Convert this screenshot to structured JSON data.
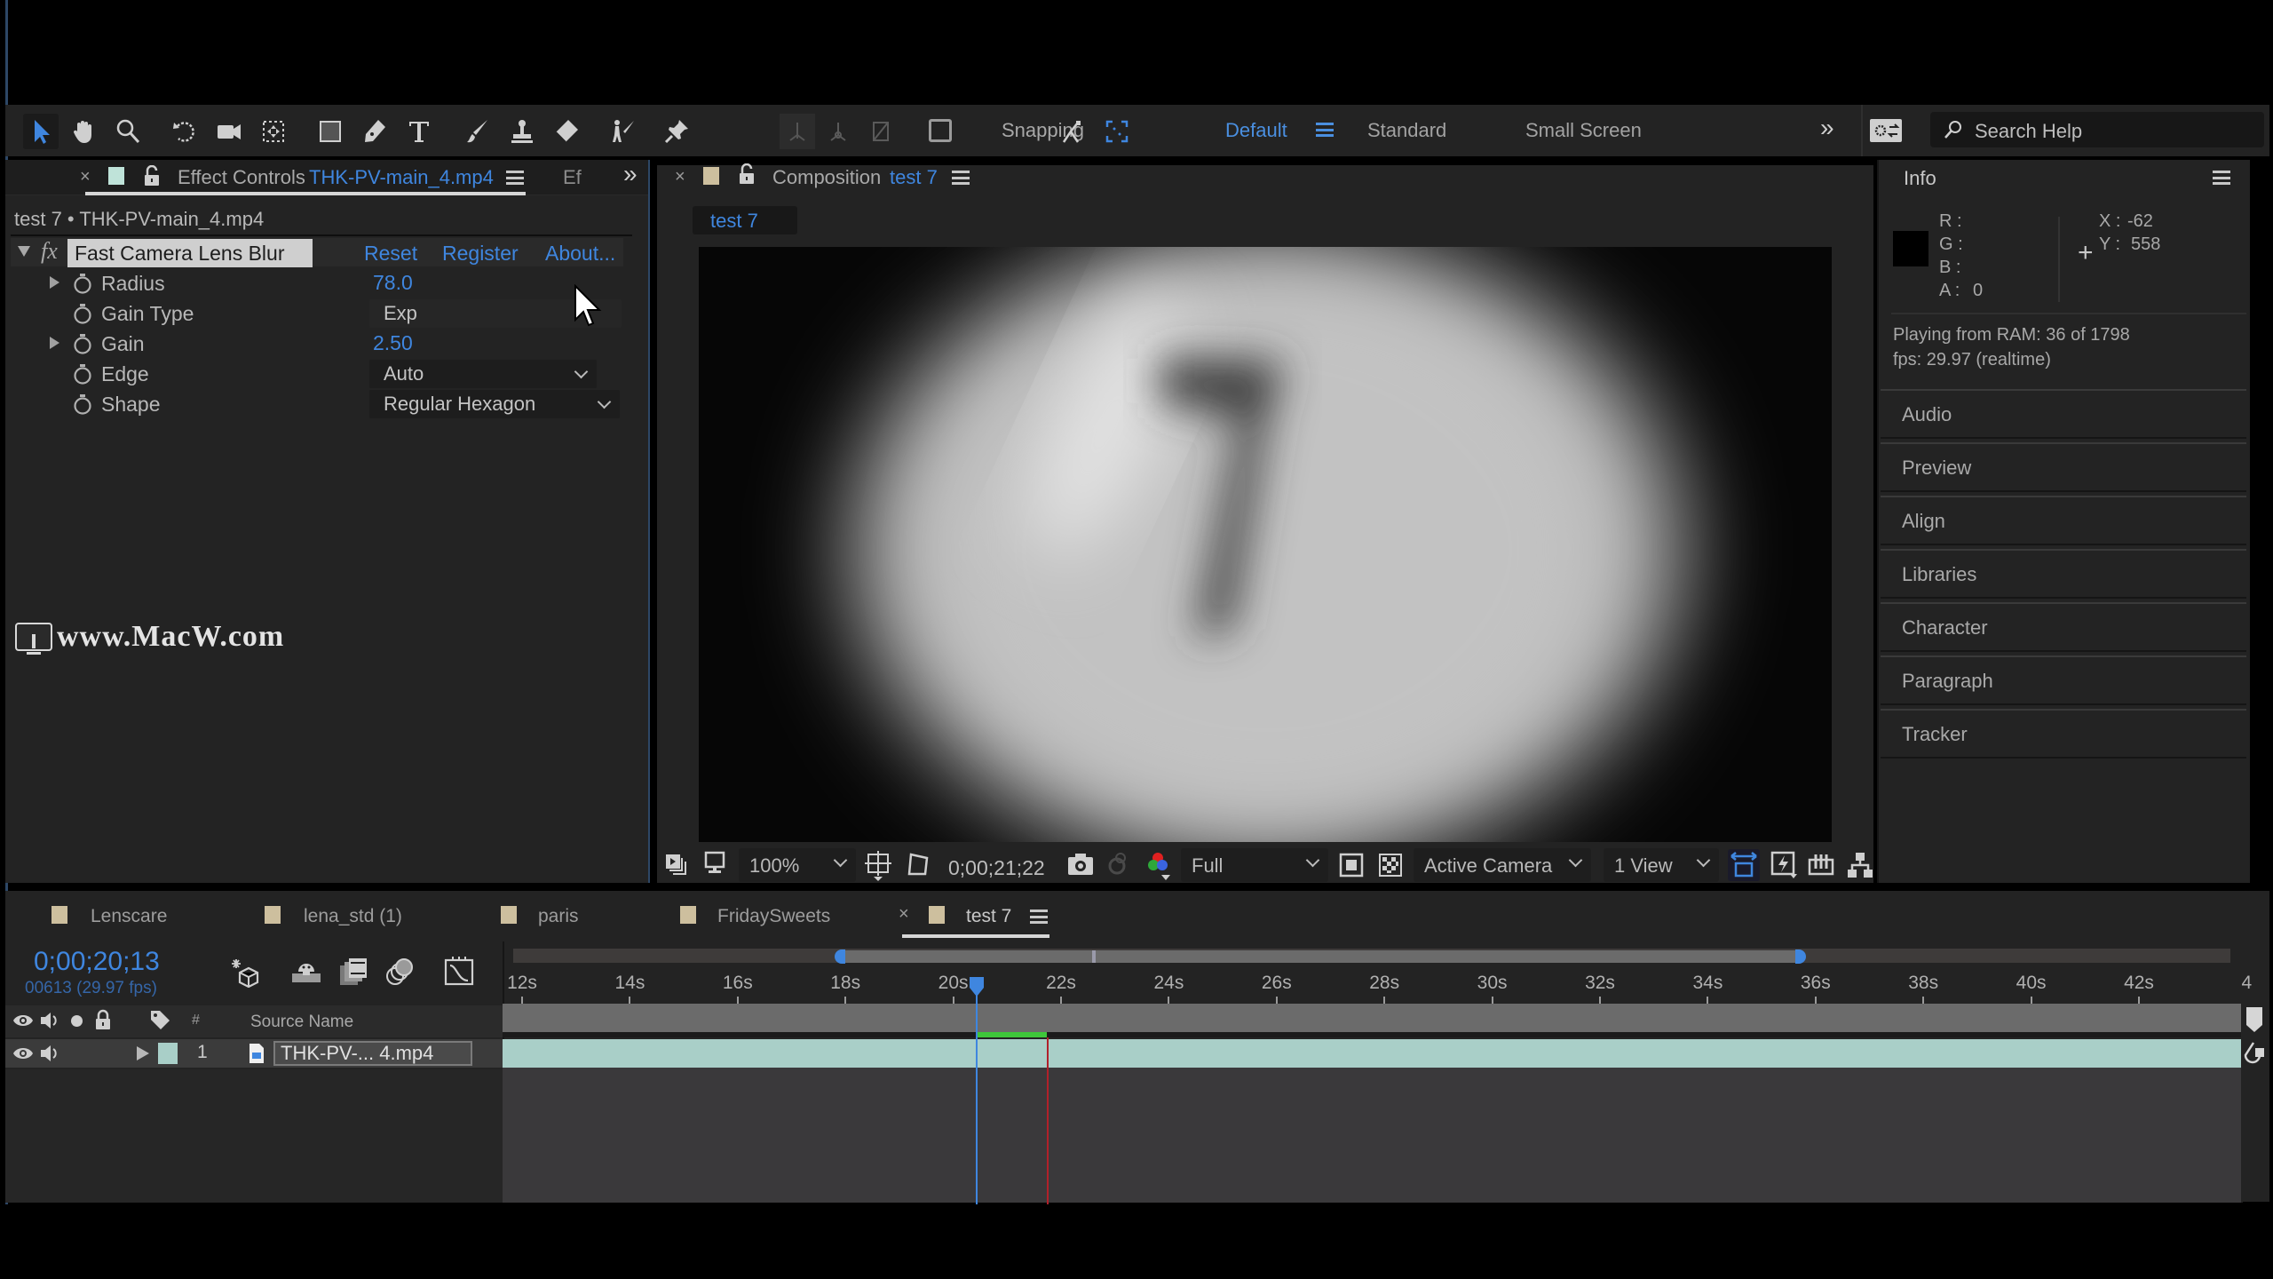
{
  "colors": {
    "accent_blue": "#3f86df",
    "layer_teal": "#a9cfc8",
    "cti_red": "#b0202a",
    "work_area_green": "#3ec63a",
    "panel_bg": "#232323"
  },
  "toolbar": {
    "tools": [
      "selection-tool",
      "hand-tool",
      "zoom-tool",
      "rotation-tool",
      "camera-tool",
      "pan-behind-tool",
      "rectangle-tool",
      "pen-tool",
      "type-tool",
      "brush-tool",
      "clone-stamp-tool",
      "eraser-tool",
      "roto-brush-tool",
      "puppet-pin-tool"
    ],
    "snapping_label": "Snapping",
    "snapping_checked": false,
    "workspaces": [
      "Default",
      "Standard",
      "Small Screen"
    ],
    "active_workspace": "Default",
    "search_placeholder": "Search Help"
  },
  "effect_controls": {
    "tab_title": "Effect Controls",
    "tab_layer": "THK-PV-main_4.mp4",
    "next_tab_truncated": "Ef",
    "breadcrumb": "test 7 • THK-PV-main_4.mp4",
    "effect_name": "Fast Camera Lens Blur",
    "links": [
      "Reset",
      "Register",
      "About..."
    ],
    "properties": [
      {
        "name": "Radius",
        "value": "78.0",
        "type": "number",
        "expandable": true
      },
      {
        "name": "Gain Type",
        "value": "Exp",
        "type": "dropdown",
        "expandable": false
      },
      {
        "name": "Gain",
        "value": "2.50",
        "type": "number",
        "expandable": true
      },
      {
        "name": "Edge",
        "value": "Auto",
        "type": "dropdown",
        "expandable": false
      },
      {
        "name": "Shape",
        "value": "Regular Hexagon",
        "type": "dropdown",
        "expandable": false
      }
    ],
    "watermark": "www.MacW.com"
  },
  "composition": {
    "tab_title": "Composition",
    "tab_comp": "test 7",
    "flowchart_crumb": "test 7",
    "frame_content": "blurred film countdown number 7",
    "footer": {
      "zoom": "100%",
      "timecode": "0;00;21;22",
      "resolution": "Full",
      "camera": "Active Camera",
      "views": "1 View"
    }
  },
  "info": {
    "title": "Info",
    "r": "",
    "g": "",
    "b": "",
    "a": "0",
    "r_label": "R :",
    "g_label": "G :",
    "b_label": "B :",
    "a_label": "A :",
    "x_label": "X :",
    "x": "-62",
    "y_label": "Y :",
    "y": "558",
    "status_line1": "Playing from RAM: 36 of 1798",
    "status_line2": "fps: 29.97 (realtime)"
  },
  "side_panels": [
    "Audio",
    "Preview",
    "Align",
    "Libraries",
    "Character",
    "Paragraph",
    "Tracker"
  ],
  "timeline": {
    "tabs": [
      "Lenscare",
      "lena_std (1)",
      "paris",
      "FridaySweets",
      "test 7"
    ],
    "active_tab": "test 7",
    "current_time": "0;00;20;13",
    "current_frame": "00613 (29.97 fps)",
    "column_hash": "#",
    "column_source_name": "Source Name",
    "ruler_ticks": [
      "12s",
      "14s",
      "16s",
      "18s",
      "20s",
      "22s",
      "24s",
      "26s",
      "28s",
      "30s",
      "32s",
      "34s",
      "36s",
      "38s",
      "40s",
      "42s",
      "4"
    ],
    "layers": [
      {
        "index": "1",
        "name": "THK-PV-... 4.mp4"
      }
    ],
    "cti_time_s": 20.44,
    "work_area_end_s": 21.74,
    "navigator_start_s": 18.0,
    "navigator_end_s": 35.0
  }
}
